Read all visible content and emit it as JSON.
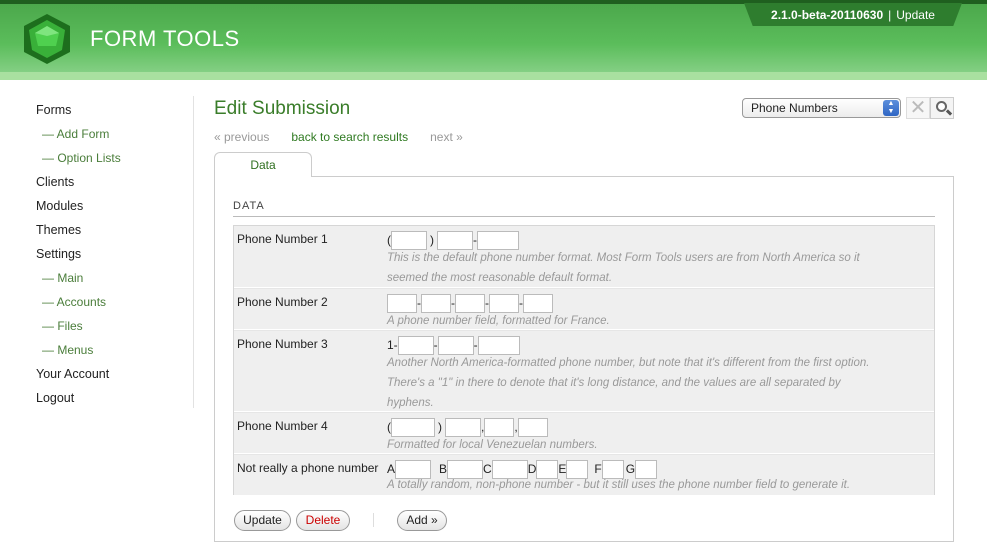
{
  "header": {
    "brand": "FORM TOOLS",
    "version": "2.1.0-beta-20110630",
    "separator": "|",
    "update_link": "Update"
  },
  "sidebar": {
    "items": [
      {
        "label": "Forms",
        "sub": false
      },
      {
        "label": "— Add Form",
        "sub": true
      },
      {
        "label": "— Option Lists",
        "sub": true
      },
      {
        "label": "Clients",
        "sub": false
      },
      {
        "label": "Modules",
        "sub": false
      },
      {
        "label": "Themes",
        "sub": false
      },
      {
        "label": "Settings",
        "sub": false
      },
      {
        "label": "— Main",
        "sub": true
      },
      {
        "label": "— Accounts",
        "sub": true
      },
      {
        "label": "— Files",
        "sub": true
      },
      {
        "label": "— Menus",
        "sub": true
      },
      {
        "label": "Your Account",
        "sub": false
      },
      {
        "label": "Logout",
        "sub": false
      }
    ]
  },
  "main": {
    "title": "Edit Submission",
    "view_select": {
      "selected": "Phone Numbers"
    },
    "pager": {
      "previous": "« previous",
      "back": "back to search results",
      "next": "next »"
    },
    "tab_label": "Data",
    "section_title": "DATA",
    "fields": [
      {
        "label": "Phone Number 1",
        "p1": "(",
        "p2": ")",
        "p3": "-",
        "description": [
          "This is the default phone number format. Most Form Tools users are from North America so it",
          "seemed the most reasonable default format."
        ]
      },
      {
        "label": "Phone Number 2",
        "p1": "-",
        "p2": "-",
        "p3": "-",
        "p4": "-",
        "description": [
          "A phone number field, formatted for France."
        ]
      },
      {
        "label": "Phone Number 3",
        "p1": "1-",
        "p2": "-",
        "p3": "-",
        "description": [
          "Another North America-formatted phone number, but note that it's different from the first option.",
          "There's a \"1\" in there to denote that it's long distance, and the values are all separated by",
          "hyphens."
        ]
      },
      {
        "label": "Phone Number 4",
        "p1": "(",
        "p2": ")",
        "p3": ",",
        "p4": ",",
        "description": [
          "Formatted for local Venezuelan numbers."
        ]
      },
      {
        "label": "Not really a phone number",
        "letters": [
          "A",
          "B",
          "C",
          "D",
          "E",
          "F",
          "G"
        ],
        "description": [
          "A totally random, non-phone number - but it still uses the phone number field to generate it."
        ]
      }
    ],
    "buttons": {
      "update": "Update",
      "delete": "Delete",
      "add": "Add »"
    }
  },
  "colors": {
    "brand_green": "#4aa64a",
    "link_green": "#2f7a21",
    "delete_red": "#cc0000"
  }
}
